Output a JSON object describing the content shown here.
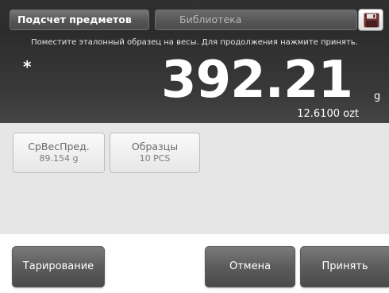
{
  "header": {
    "app_tab_label": "Подсчет предметов",
    "library_tab_label": "Библиотека",
    "save_icon": "save-icon"
  },
  "display": {
    "instruction": "Поместите эталонный образец на весы. Для продолжения нажмите принять.",
    "stable_marker": "*",
    "weight_value": "392.21",
    "weight_unit": "g",
    "secondary_reading": "12.6100 ozt"
  },
  "cards": [
    {
      "title": "СрВесПред.",
      "value": "89.154 g"
    },
    {
      "title": "Образцы",
      "value": "10 PCS"
    }
  ],
  "buttons": {
    "tare": "Тарирование",
    "cancel": "Отмена",
    "accept": "Принять"
  },
  "colors": {
    "display_background": "#2e2e2e",
    "work_area_background": "#e6e6e6",
    "button_background": "#5c5c5c"
  }
}
